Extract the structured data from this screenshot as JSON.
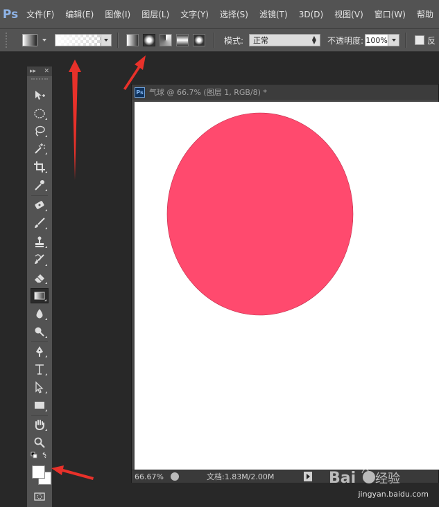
{
  "app": {
    "logo": "Ps"
  },
  "menu": [
    "文件(F)",
    "编辑(E)",
    "图像(I)",
    "图层(L)",
    "文字(Y)",
    "选择(S)",
    "滤镜(T)",
    "3D(D)",
    "视图(V)",
    "窗口(W)",
    "帮助"
  ],
  "options": {
    "mode_label": "模式:",
    "mode_value": "正常",
    "opacity_label": "不透明度:",
    "opacity_value": "100%",
    "reverse_label": "反",
    "gradient_types": [
      "linear",
      "radial",
      "angle",
      "reflected",
      "diamond"
    ],
    "active_gradient_type": "radial"
  },
  "document": {
    "ps_badge": "Ps",
    "title": "气球 @ 66.7% (图层 1, RGB/8) *",
    "circle_color": "#ff4a6e",
    "zoom": "66.67%",
    "doc_size": "文档:1.83M/2.00M"
  },
  "tools": [
    "move",
    "marquee",
    "lasso",
    "magic-wand",
    "crop",
    "eyedropper",
    "healing",
    "brush",
    "stamp",
    "history-brush",
    "eraser",
    "gradient",
    "blur",
    "dodge",
    "pen",
    "type",
    "path-select",
    "shape",
    "hand",
    "zoom"
  ],
  "active_tool": "gradient",
  "watermark": {
    "text": "jingyan.baidu.com"
  },
  "colors": {
    "annotation_arrow": "#e8312a",
    "ui_panel": "#535353",
    "workspace": "#282828"
  }
}
